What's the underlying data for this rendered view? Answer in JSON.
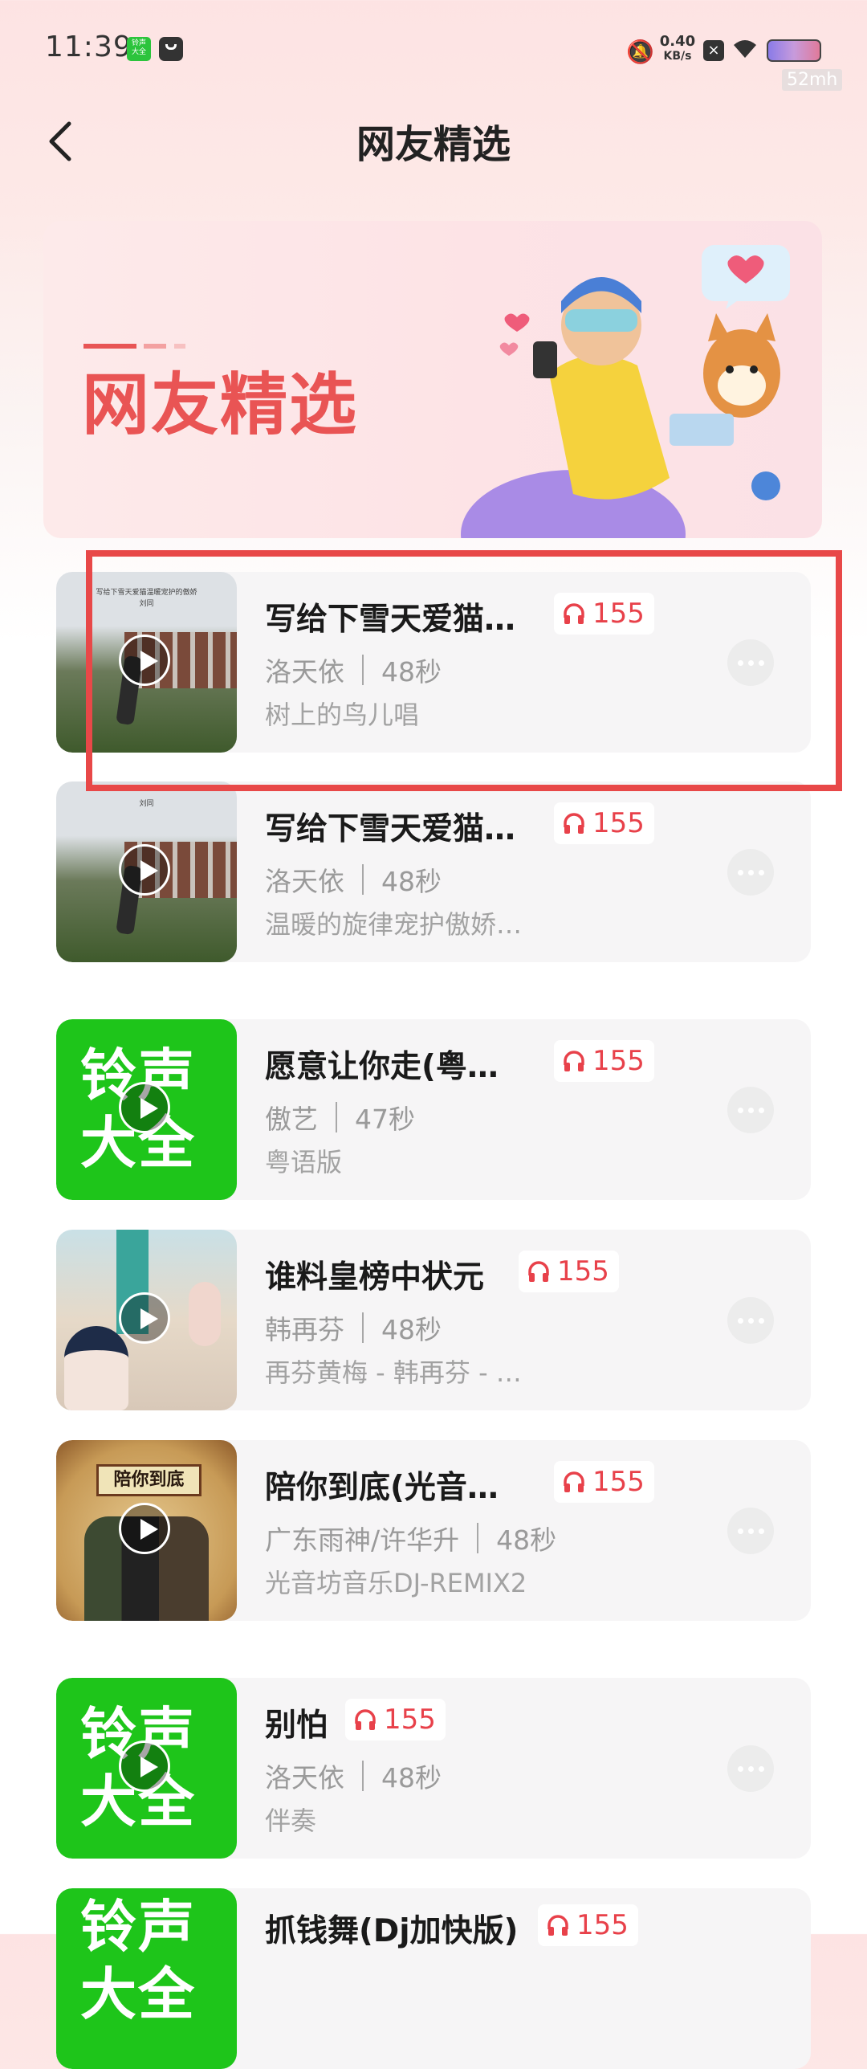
{
  "status_bar": {
    "time": "11:39",
    "app_icon_text": "铃声\n大全",
    "net_speed_value": "0.40",
    "net_speed_unit": "KB/s",
    "refresh_badge": "52mh"
  },
  "header": {
    "title": "网友精选"
  },
  "banner": {
    "text": "网友精选"
  },
  "songs": [
    {
      "title": "写给下雪天爱猫…",
      "plays": "155",
      "artist": "洛天依",
      "duration": "48秒",
      "desc": "树上的鸟儿唱",
      "thumb_caption": "写给下雪天爱猫温暖宠护的傲娇",
      "thumb_caption_sub": "刘同"
    },
    {
      "title": "写给下雪天爱猫…",
      "plays": "155",
      "artist": "洛天依",
      "duration": "48秒",
      "desc": "温暖的旋律宠护傲娇…",
      "thumb_caption_sub": "刘同"
    },
    {
      "title": "愿意让你走(粤…",
      "plays": "155",
      "artist": "傲艺",
      "duration": "47秒",
      "desc": "粤语版",
      "thumb_text_1": "铃声",
      "thumb_text_2": "大全"
    },
    {
      "title": "谁料皇榜中状元",
      "plays": "155",
      "artist": "韩再芬",
      "duration": "48秒",
      "desc": "再芬黄梅 - 韩再芬 - …"
    },
    {
      "title": "陪你到底(光音…",
      "plays": "155",
      "artist": "广东雨神/许华升",
      "duration": "48秒",
      "desc": "光音坊音乐DJ-REMIX2",
      "thumb_title": "陪你到底"
    },
    {
      "title": "别怕",
      "plays": "155",
      "artist": "洛天依",
      "duration": "48秒",
      "desc": "伴奏",
      "thumb_text_1": "铃声",
      "thumb_text_2": "大全"
    },
    {
      "title": "抓钱舞(Dj加快版)",
      "plays": "155",
      "thumb_text_1": "铃声",
      "thumb_text_2": "大全"
    }
  ],
  "colors": {
    "accent_red": "#e8414a",
    "highlight_box": "#e84848",
    "ringtone_green": "#1ec51a"
  }
}
